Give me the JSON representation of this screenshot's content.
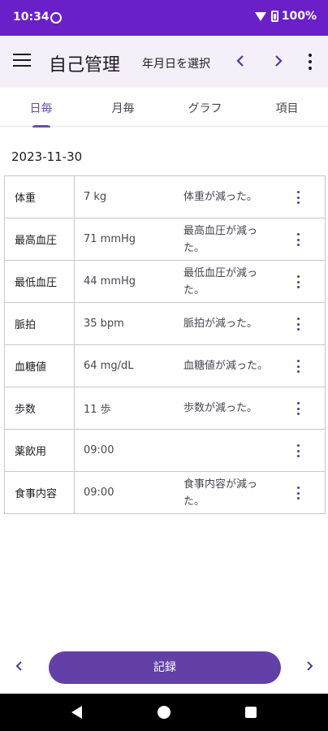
{
  "status_bar": {
    "time": "10:34",
    "battery": "100%"
  },
  "app_bar": {
    "title": "自己管理",
    "date_select": "年月日を選択",
    "icons": [
      "menu-icon",
      "chevron-left-icon",
      "chevron-right-icon",
      "more-vert-icon"
    ]
  },
  "tabs": [
    {
      "label": "日毎",
      "active": true
    },
    {
      "label": "月毎",
      "active": false
    },
    {
      "label": "グラフ",
      "active": false
    },
    {
      "label": "項目",
      "active": false
    }
  ],
  "date": "2023-11-30",
  "rows": [
    {
      "name": "体重",
      "value": "7 kg",
      "note": "体重が減った。"
    },
    {
      "name": "最高血圧",
      "value": "71 mmHg",
      "note": "最高血圧が減った。"
    },
    {
      "name": "最低血圧",
      "value": "44 mmHg",
      "note": "最低血圧が減った。"
    },
    {
      "name": "脈拍",
      "value": "35 bpm",
      "note": "脈拍が減った。"
    },
    {
      "name": "血糖値",
      "value": "64 mg/dL",
      "note": "血糖値が減った。"
    },
    {
      "name": "歩数",
      "value": "11 歩",
      "note": "歩数が減った。"
    },
    {
      "name": "薬飲用",
      "value": "09:00",
      "note": ""
    },
    {
      "name": "食事内容",
      "value": "09:00",
      "note": "食事内容が減った。"
    }
  ],
  "record_button": "記録",
  "colors": {
    "status_bar": "#6a1fc9",
    "accent": "#6750a4",
    "button": "#6340a8",
    "app_bar": "#f4eff8"
  }
}
